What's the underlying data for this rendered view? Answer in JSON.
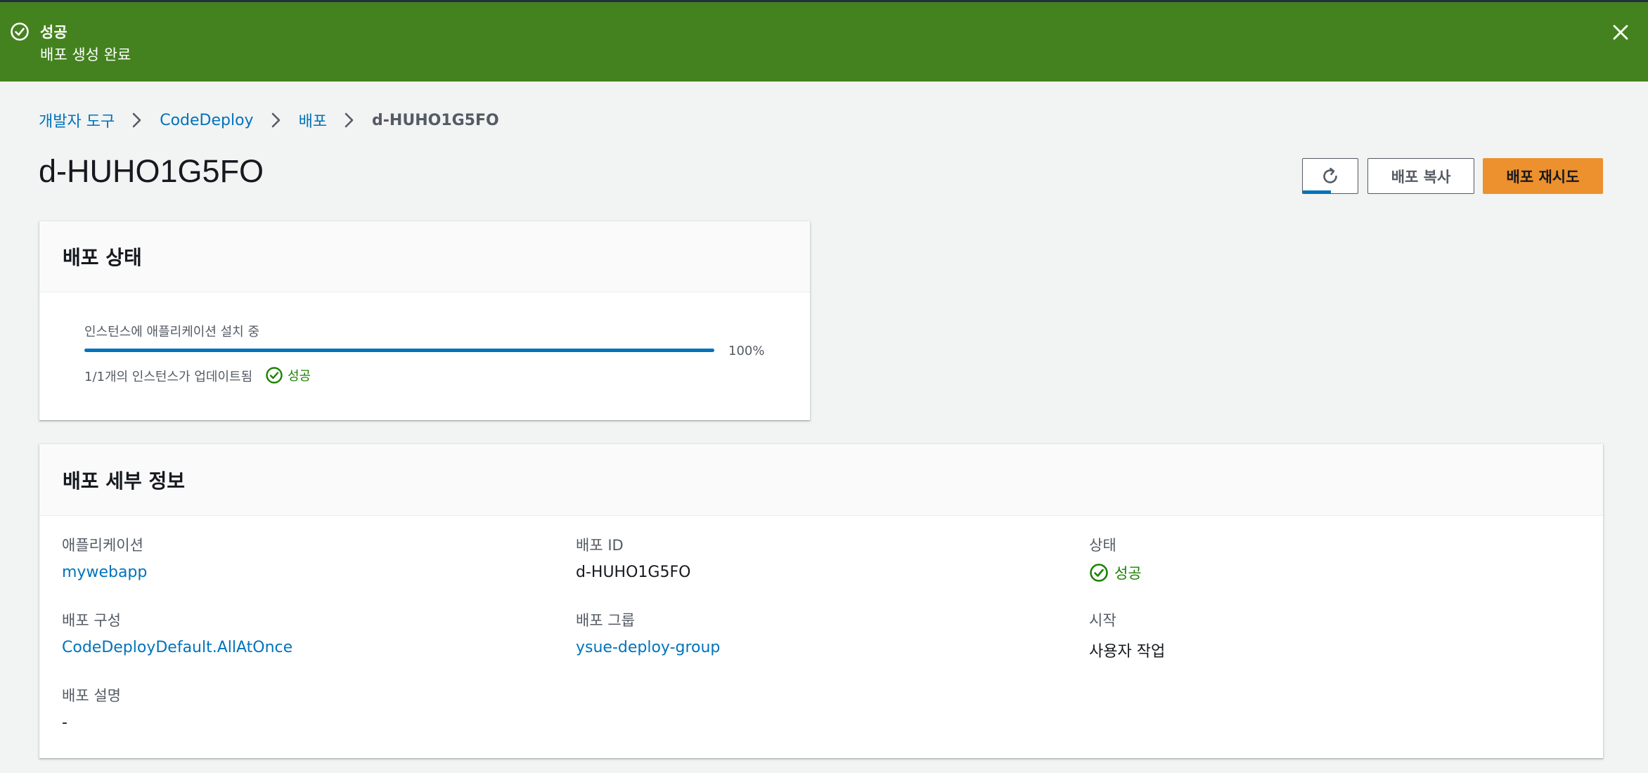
{
  "flash": {
    "title": "성공",
    "message": "배포 생성 완료",
    "icons": {
      "status": "check-circle-icon",
      "close": "close-icon"
    },
    "color": "#44821f"
  },
  "breadcrumb": [
    "개발자 도구",
    "CodeDeploy",
    "배포",
    "d-HUHO1G5FO"
  ],
  "page": {
    "title": "d-HUHO1G5FO"
  },
  "actions": {
    "refresh_icon": "refresh-icon",
    "copy_label": "배포 복사",
    "retry_label": "배포 재시도",
    "primary_color": "#ec912d"
  },
  "status_panel": {
    "title": "배포 상태",
    "progress_label": "인스턴스에 애플리케이션 설치 중",
    "progress_percent_value": 100,
    "progress_percent_text": "100%",
    "instances_text": "1/1개의 인스턴스가 업데이트됨",
    "status_text": "성공"
  },
  "details": {
    "title": "배포 세부 정보",
    "application": {
      "label": "애플리케이션",
      "value": "mywebapp"
    },
    "deployment_id": {
      "label": "배포 ID",
      "value": "d-HUHO1G5FO"
    },
    "status": {
      "label": "상태",
      "value": "성공"
    },
    "config": {
      "label": "배포 구성",
      "value": "CodeDeployDefault.AllAtOnce"
    },
    "group": {
      "label": "배포 그룹",
      "value": "ysue-deploy-group"
    },
    "started": {
      "label": "시작",
      "value": "사용자 작업"
    },
    "description": {
      "label": "배포 설명",
      "value": "-"
    }
  },
  "colors": {
    "link": "#0073bb",
    "success": "#1d8102"
  }
}
